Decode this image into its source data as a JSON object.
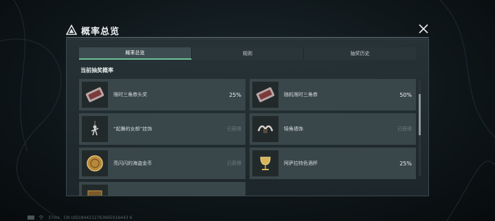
{
  "dialog": {
    "title": "概率总览",
    "tabs": [
      "概率总览",
      "规则",
      "抽奖历史"
    ],
    "active_tab": 0,
    "section_title": "当前抽奖概率"
  },
  "items": [
    {
      "name": "限时三角券头奖",
      "value": "25%",
      "obtained": false,
      "icon": "ticket-icon"
    },
    {
      "name": "随机限时三角券",
      "value": "50%",
      "obtained": false,
      "icon": "ticket-icon"
    },
    {
      "name": "“起舞的女郎”挂饰",
      "value": "已获得",
      "obtained": true,
      "icon": "dancer-charm-icon"
    },
    {
      "name": "犄角墙饰",
      "value": "已获得",
      "obtained": true,
      "icon": "horn-decor-icon"
    },
    {
      "name": "亮闪闪的海盗金币",
      "value": "已获得",
      "obtained": true,
      "icon": "gold-coin-icon"
    },
    {
      "name": "阿萨拉特色酒杯",
      "value": "25%",
      "obtained": false,
      "icon": "goblet-icon"
    },
    {
      "name": "",
      "value": "",
      "obtained": false,
      "icon": "item-icon"
    }
  ],
  "status": {
    "ping": "37ms",
    "uid": "CN UID1844212763665016443 6"
  }
}
